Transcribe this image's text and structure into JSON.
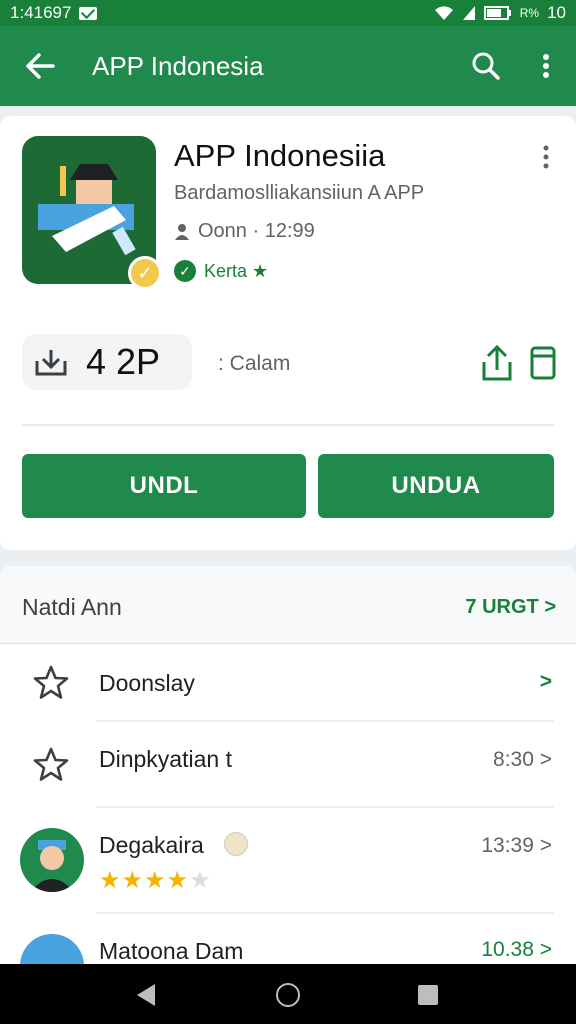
{
  "status_bar": {
    "time": "1:41697",
    "battery": "10",
    "network": "R%"
  },
  "app_bar": {
    "title": "APP Indonesia"
  },
  "app": {
    "name": "APP Indonesiia",
    "developer": "Bardamoslliakansiiun A APP",
    "meta": "Oonn · 12:99",
    "verified_label": "Kerta ★"
  },
  "stats": {
    "downloads": "4 2P",
    "category": ": Calam"
  },
  "buttons": {
    "primary": "UNDL",
    "secondary": "UNDUA"
  },
  "section": {
    "title": "Natdi Ann",
    "link": "7 URGT >",
    "rows": [
      {
        "label": "Doonslay",
        "value": "",
        "chevron": ">"
      },
      {
        "label": "Dinpkyatian t",
        "value": "8:30 >",
        "chevron": ""
      },
      {
        "label": "Degakaira",
        "value": "13:39 >",
        "rating": "4",
        "rating_max": "5"
      },
      {
        "label": "Matoona Dam",
        "value": "10.38 >"
      }
    ]
  },
  "colors": {
    "primary": "#1f8a4c",
    "status_bar": "#188038",
    "star": "#f4b400"
  }
}
